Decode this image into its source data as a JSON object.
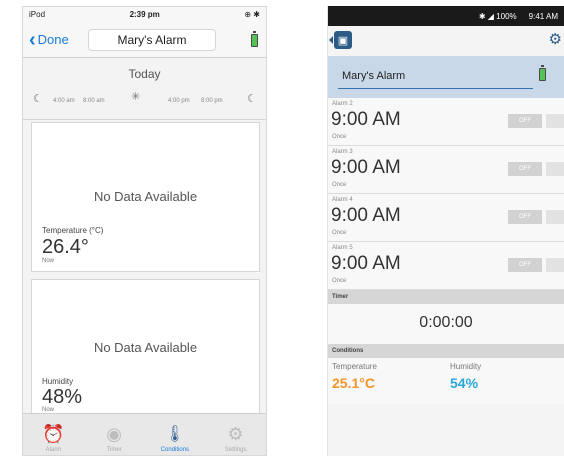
{
  "ios": {
    "status": {
      "carrier": "iPod",
      "time": "2:39 pm",
      "right": "⊕ ✱"
    },
    "nav": {
      "back_label": "Done",
      "title": "Mary's Alarm"
    },
    "timeline": {
      "heading": "Today",
      "ticks": [
        "4:00 am",
        "8:00 am",
        "4:00 pm",
        "8:00 pm"
      ]
    },
    "cards": [
      {
        "message": "No Data Available",
        "label": "Temperature (°C)",
        "value": "26.4°",
        "sub": "Now"
      },
      {
        "message": "No Data Available",
        "label": "Humidity",
        "value": "48%",
        "sub": "Now"
      }
    ],
    "tabs": [
      {
        "label": "Alarm",
        "icon": "alarm-clock-icon"
      },
      {
        "label": "Timer",
        "icon": "timer-icon"
      },
      {
        "label": "Conditions",
        "icon": "thermometer-drop-icon",
        "active": true
      },
      {
        "label": "Settings",
        "icon": "gear-icon"
      }
    ]
  },
  "android": {
    "status": {
      "signal": "✱ ◢ 100%",
      "time": "9:41 AM"
    },
    "name_field": "Mary's Alarm",
    "alarms": [
      {
        "label": "Alarm 2",
        "time": "9:00 AM",
        "repeat": "Once",
        "toggle": "OFF"
      },
      {
        "label": "Alarm 3",
        "time": "9:00 AM",
        "repeat": "Once",
        "toggle": "OFF"
      },
      {
        "label": "Alarm 4",
        "time": "9:00 AM",
        "repeat": "Once",
        "toggle": "OFF"
      },
      {
        "label": "Alarm 5",
        "time": "9:00 AM",
        "repeat": "Once",
        "toggle": "OFF"
      }
    ],
    "timer_section": "Timer",
    "timer_value": "0:00:00",
    "conditions_section": "Conditions",
    "conditions": [
      {
        "label": "Temperature",
        "value": "25.1°C",
        "color": "#f0962a"
      },
      {
        "label": "Humidity",
        "value": "54%",
        "color": "#2aa7d6"
      }
    ]
  }
}
